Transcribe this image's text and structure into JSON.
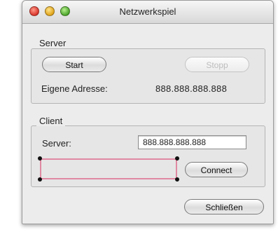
{
  "window": {
    "title": "Netzwerkspiel"
  },
  "server_group": {
    "label": "Server",
    "start_button": "Start",
    "stop_button": "Stopp",
    "own_address_label": "Eigene Adresse:",
    "own_address_value": "888.888.888.888"
  },
  "client_group": {
    "label": "Client",
    "server_label": "Server:",
    "server_field_value": "888.888.888.888",
    "custom_view_value": "",
    "connect_button": "Connect"
  },
  "footer": {
    "close_button": "Schließen"
  },
  "colors": {
    "selection_border": "#e089a3",
    "window_bg": "#ececec"
  }
}
